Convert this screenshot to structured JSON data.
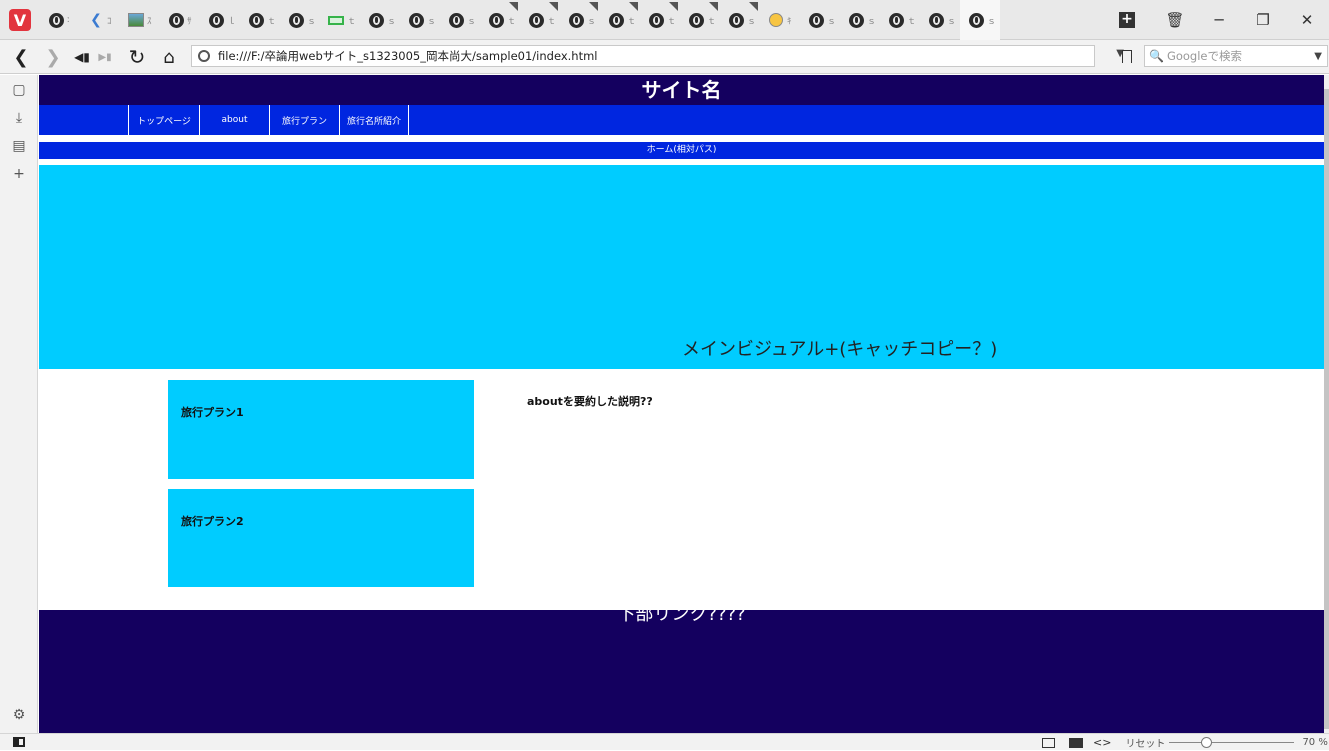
{
  "tabs": [
    {
      "icon": "globe-icon",
      "label": "ː",
      "pinned": false
    },
    {
      "icon": "bird-icon",
      "label": "ｺ",
      "pinned": false
    },
    {
      "icon": "image-icon",
      "label": "ｽ",
      "pinned": false
    },
    {
      "icon": "globe-icon",
      "label": "ｻ",
      "pinned": false
    },
    {
      "icon": "globe-icon",
      "label": "ｌ",
      "pinned": false
    },
    {
      "icon": "globe-icon",
      "label": "ｔ",
      "pinned": false
    },
    {
      "icon": "globe-icon",
      "label": "ｓ",
      "pinned": false
    },
    {
      "icon": "rect-icon",
      "label": "ｔ",
      "pinned": false
    },
    {
      "icon": "globe-icon",
      "label": "ｓ",
      "pinned": false
    },
    {
      "icon": "globe-icon",
      "label": "ｓ",
      "pinned": false
    },
    {
      "icon": "globe-icon",
      "label": "ｓ",
      "pinned": false
    },
    {
      "icon": "globe-icon",
      "label": "ｔ",
      "pinned": true
    },
    {
      "icon": "globe-icon",
      "label": "ｔ",
      "pinned": true
    },
    {
      "icon": "globe-icon",
      "label": "ｓ",
      "pinned": true
    },
    {
      "icon": "globe-icon",
      "label": "ｔ",
      "pinned": true
    },
    {
      "icon": "globe-icon",
      "label": "ｔ",
      "pinned": true
    },
    {
      "icon": "globe-icon",
      "label": "ｔ",
      "pinned": true
    },
    {
      "icon": "globe-icon",
      "label": "ｓ",
      "pinned": true
    },
    {
      "icon": "face-icon",
      "label": "ｷ",
      "pinned": false
    },
    {
      "icon": "globe-icon",
      "label": "ｓ",
      "pinned": false
    },
    {
      "icon": "globe-icon",
      "label": "ｓ",
      "pinned": false
    },
    {
      "icon": "globe-icon",
      "label": "ｔ",
      "pinned": false
    },
    {
      "icon": "globe-icon",
      "label": "ｓ",
      "pinned": false
    },
    {
      "icon": "globe-icon",
      "label": "ｓ",
      "pinned": false,
      "active": true
    }
  ],
  "window": {
    "trash_icon": "trash-icon",
    "minimize": "─",
    "maximize": "❐",
    "close": "✕"
  },
  "address": {
    "url": "file:///F:/卒論用webサイト_s1323005_岡本尚大/sample01/index.html",
    "search_placeholder": "Googleで検索"
  },
  "page": {
    "site_name": "サイト名",
    "nav": [
      "トップページ",
      "about",
      "旅行プラン",
      "旅行名所紹介"
    ],
    "breadcrumb": "ホーム(相対パス)",
    "catch_copy": "メインビジュアル+(キャッチコピー？)",
    "plans": [
      "旅行プラン1",
      "旅行プラン2"
    ],
    "about_summary": "aboutを要約した説明??",
    "footer": "下部リンク????"
  },
  "statusbar": {
    "reset": "リセット",
    "zoom": "70 %"
  },
  "colors": {
    "header_bg": "#14005f",
    "nav_bg": "#0026e0",
    "visual_bg": "#00ccff",
    "footer_bg": "#14005f"
  }
}
